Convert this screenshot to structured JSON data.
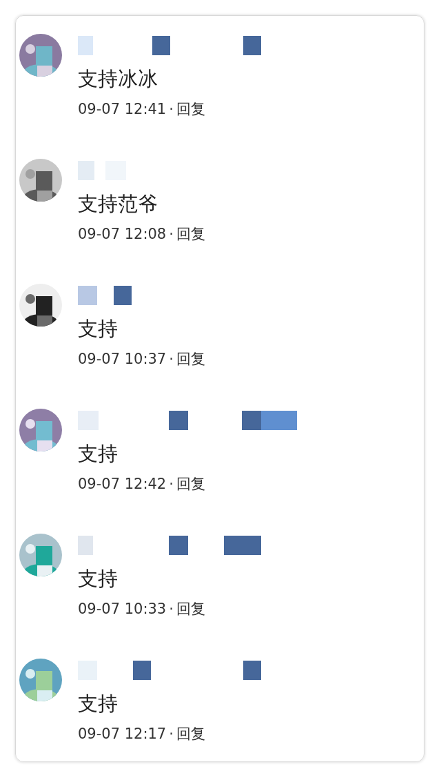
{
  "comments": [
    {
      "text": "支持冰冰",
      "time": "09-07 12:41",
      "separator": "·",
      "reply": "回复"
    },
    {
      "text": "支持范爷",
      "time": "09-07 12:08",
      "separator": "·",
      "reply": "回复"
    },
    {
      "text": "支持",
      "time": "09-07 10:37",
      "separator": "·",
      "reply": "回复"
    },
    {
      "text": "支持",
      "time": "09-07 12:42",
      "separator": "·",
      "reply": "回复"
    },
    {
      "text": "支持",
      "time": "09-07 10:33",
      "separator": "·",
      "reply": "回复"
    },
    {
      "text": "支持",
      "time": "09-07 12:17",
      "separator": "·",
      "reply": "回复"
    }
  ]
}
